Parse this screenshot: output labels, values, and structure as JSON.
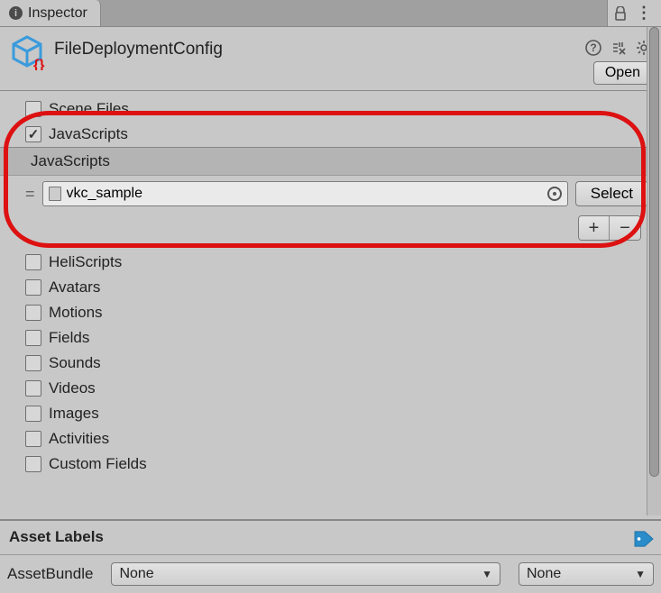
{
  "tab": {
    "title": "Inspector"
  },
  "asset": {
    "title": "FileDeploymentConfig",
    "open_label": "Open"
  },
  "sections": {
    "scene_files": {
      "label": "Scene Files",
      "checked": false
    },
    "javascripts": {
      "label": "JavaScripts",
      "checked": true,
      "header": "JavaScripts"
    },
    "heliscripts": {
      "label": "HeliScripts",
      "checked": false
    },
    "avatars": {
      "label": "Avatars",
      "checked": false
    },
    "motions": {
      "label": "Motions",
      "checked": false
    },
    "fields": {
      "label": "Fields",
      "checked": false
    },
    "sounds": {
      "label": "Sounds",
      "checked": false
    },
    "videos": {
      "label": "Videos",
      "checked": false
    },
    "images": {
      "label": "Images",
      "checked": false
    },
    "activities": {
      "label": "Activities",
      "checked": false
    },
    "custom_fields": {
      "label": "Custom Fields",
      "checked": false
    }
  },
  "javascripts_item": {
    "value": "vkc_sample",
    "select_label": "Select"
  },
  "asset_labels": {
    "title": "Asset Labels"
  },
  "bundle": {
    "label": "AssetBundle",
    "value1": "None",
    "value2": "None"
  }
}
